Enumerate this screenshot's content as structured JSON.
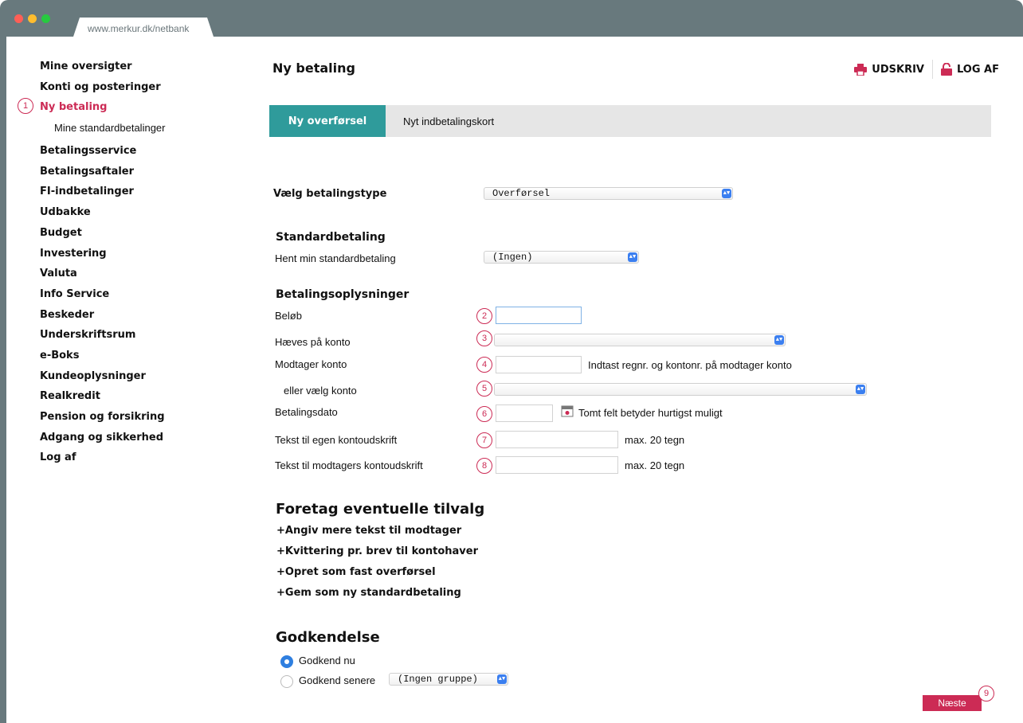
{
  "browser": {
    "url": "www.merkur.dk/netbank"
  },
  "sidebar": {
    "items": [
      {
        "label": "Mine oversigter"
      },
      {
        "label": "Konti og posteringer"
      },
      {
        "label": "Ny betaling",
        "active": true,
        "step": "1"
      },
      {
        "label": "Mine standardbetalinger",
        "sub": true
      },
      {
        "label": "Betalingsservice"
      },
      {
        "label": "Betalingsaftaler"
      },
      {
        "label": "FI-indbetalinger"
      },
      {
        "label": "Udbakke"
      },
      {
        "label": "Budget"
      },
      {
        "label": "Investering"
      },
      {
        "label": "Valuta"
      },
      {
        "label": "Info Service"
      },
      {
        "label": "Beskeder"
      },
      {
        "label": "Underskriftsrum"
      },
      {
        "label": "e-Boks"
      },
      {
        "label": "Kundeoplysninger"
      },
      {
        "label": "Realkredit"
      },
      {
        "label": "Pension og forsikring"
      },
      {
        "label": "Adgang og sikkerhed"
      },
      {
        "label": "Log af"
      }
    ]
  },
  "header": {
    "title": "Ny betaling",
    "print_label": "UDSKRIV",
    "logout_label": "LOG AF"
  },
  "tabs": [
    {
      "label": "Ny overførsel",
      "active": true
    },
    {
      "label": "Nyt indbetalingskort",
      "active": false
    }
  ],
  "form": {
    "payment_type_label": "Vælg betalingstype",
    "payment_type_value": "Overførsel",
    "standard_heading": "Standardbetaling",
    "standard_label": "Hent min standardbetaling",
    "standard_value": "(Ingen)",
    "info_heading": "Betalingsoplysninger",
    "amount_label": "Beløb",
    "from_account_label": "Hæves på konto",
    "to_account_label": "Modtager konto",
    "to_account_hint": "Indtast regnr. og kontonr. på modtager konto",
    "or_choose_label": "eller vælg konto",
    "date_label": "Betalingsdato",
    "date_hint": "Tomt felt betyder hurtigst muligt",
    "own_text_label": "Tekst til egen kontoudskrift",
    "own_text_hint": "max. 20 tegn",
    "recipient_text_label": "Tekst til modtagers kontoudskrift",
    "recipient_text_hint": "max. 20 tegn"
  },
  "steps": [
    "1",
    "2",
    "3",
    "4",
    "5",
    "6",
    "7",
    "8",
    "9"
  ],
  "options": {
    "heading": "Foretag eventuelle tilvalg",
    "items": [
      "Angiv mere tekst til modtager",
      "Kvittering pr. brev til kontohaver",
      "Opret som fast overførsel",
      "Gem som ny standardbetaling"
    ],
    "prefix": "+"
  },
  "approval": {
    "heading": "Godkendelse",
    "now_label": "Godkend nu",
    "later_label": "Godkend senere",
    "group_value": "(Ingen gruppe)"
  },
  "next_label": "Næste",
  "colors": {
    "accent": "#cc2b55",
    "tab_active": "#2f9b9b",
    "select_arrow": "#3b7ff0"
  }
}
